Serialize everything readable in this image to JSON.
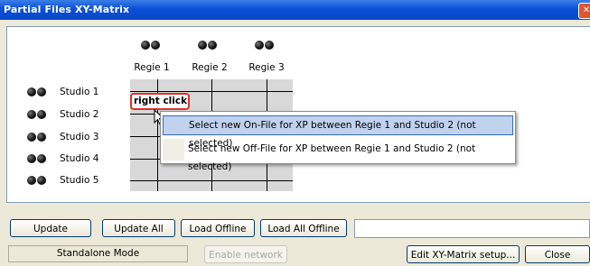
{
  "window": {
    "title": "Partial Files XY-Matrix"
  },
  "matrix": {
    "columns": [
      "Regie 1",
      "Regie 2",
      "Regie 3"
    ],
    "rows": [
      "Studio 1",
      "Studio 2",
      "Studio 3",
      "Studio 4",
      "Studio 5"
    ]
  },
  "callout": {
    "text": "right click"
  },
  "context_menu": {
    "items": [
      "Select new On-File for XP between Regie 1 and Studio 2 (not selected)",
      "Select new Off-File for XP between Regie 1 and Studio 2 (not selected)"
    ],
    "selected_index": 0
  },
  "buttons": {
    "update": "Update",
    "update_all": "Update All",
    "load_offline": "Load Offline",
    "load_all_offline": "Load All Offline",
    "enable_network": "Enable network",
    "edit_setup": "Edit XY-Matrix setup...",
    "close": "Close"
  },
  "status": {
    "mode": "Standalone Mode"
  },
  "colors": {
    "titlebar": "#0a4fd8",
    "selection": "#c1d2ee",
    "callout_border": "#d9332e"
  }
}
